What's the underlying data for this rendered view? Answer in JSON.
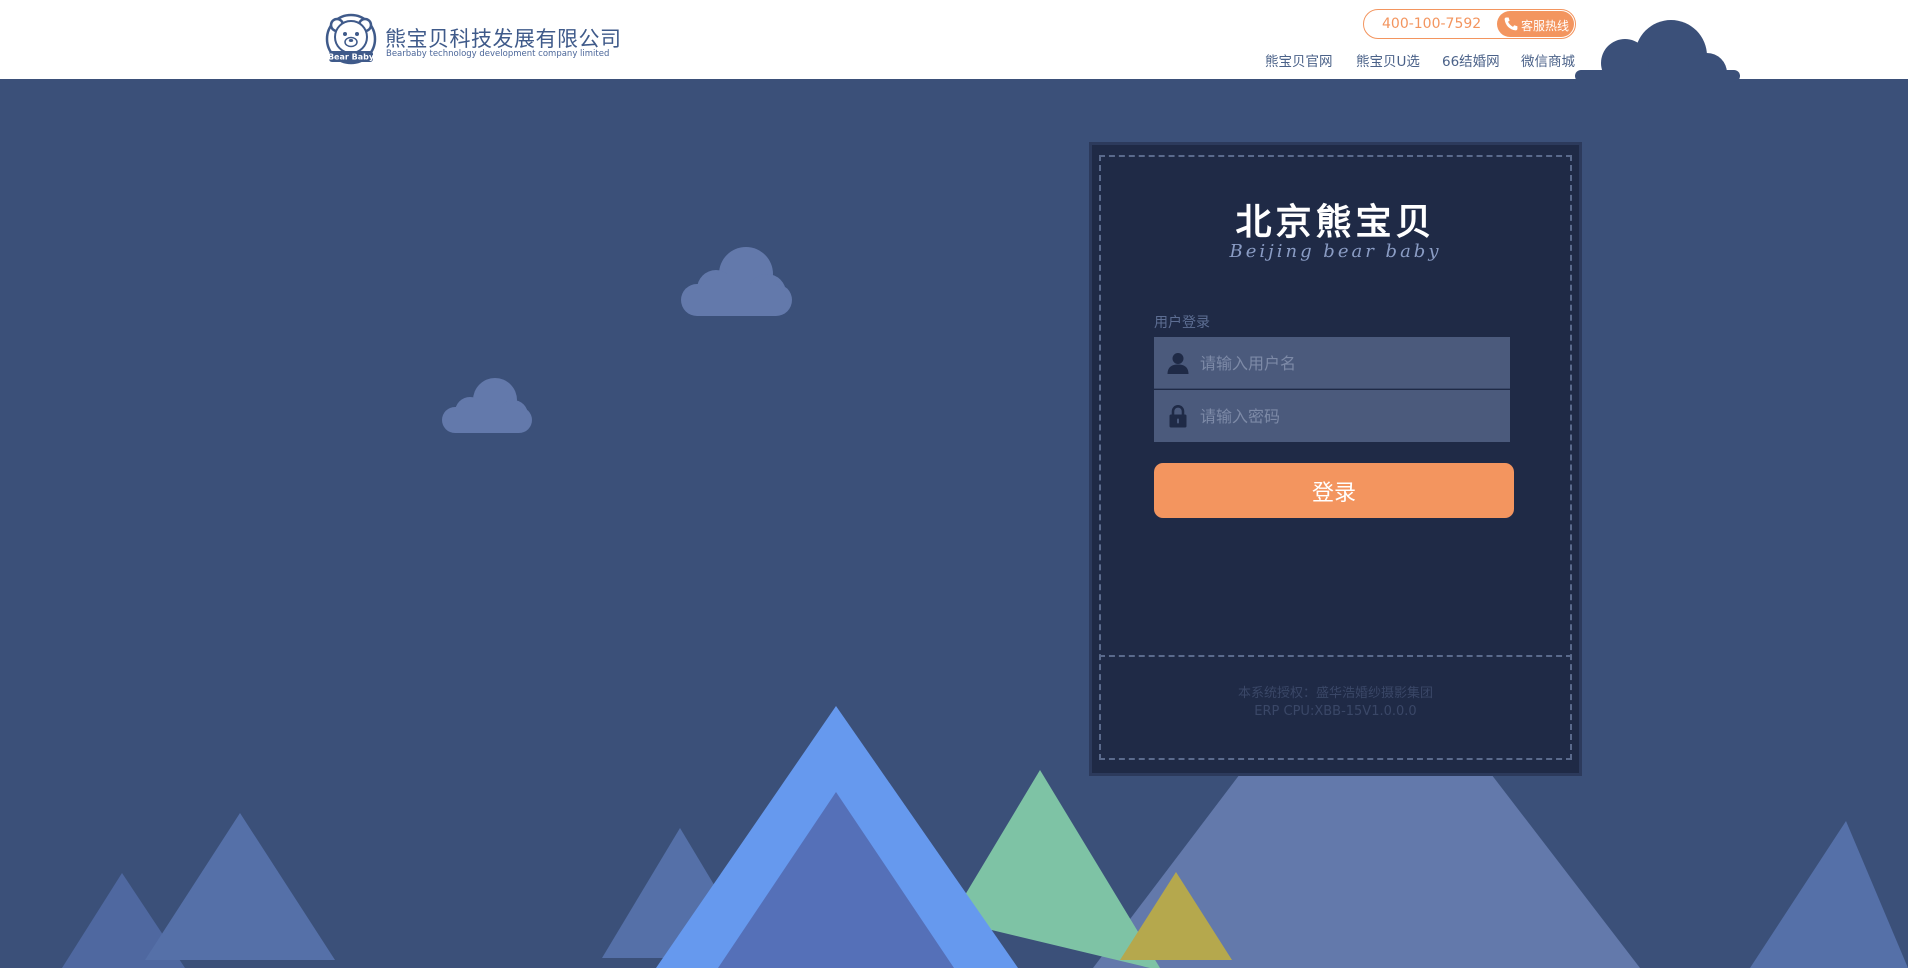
{
  "header": {
    "logo_badge": "Bear Baby",
    "company_name": "熊宝贝科技发展有限公司",
    "company_name_en": "Bearbaby technology development company limited",
    "hotline_number": "400-100-7592",
    "hotline_label": "客服热线",
    "nav": [
      {
        "label": "熊宝贝官网"
      },
      {
        "label": "熊宝贝U选"
      },
      {
        "label": "66结婚网"
      },
      {
        "label": "微信商城"
      }
    ]
  },
  "login": {
    "brand_cn": "北京熊宝贝",
    "brand_en": "Beijing bear baby",
    "section_label": "用户登录",
    "username_placeholder": "请输入用户名",
    "password_placeholder": "请输入密码",
    "submit_label": "登录",
    "copyright_line1": "本系统授权：盛华浩婚纱摄影集团",
    "copyright_line2": "ERP CPU:XBB-15V1.0.0.0"
  },
  "colors": {
    "background": "#3b5079",
    "card": "#1f2a46",
    "accent": "#f3955f",
    "cloud": "#6379ab"
  },
  "icons": [
    "bear-logo-icon",
    "phone-icon",
    "user-icon",
    "lock-icon"
  ]
}
